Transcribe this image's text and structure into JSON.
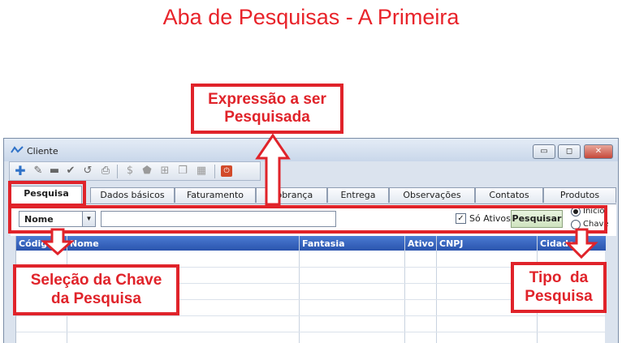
{
  "page_title": "Aba de Pesquisas - A Primeira",
  "window": {
    "title": "Cliente",
    "controls": {
      "minimize": "▭",
      "maximize": "◻",
      "close": "✕"
    }
  },
  "toolbar": {
    "icons": [
      "add-icon",
      "edit-icon",
      "delete-icon",
      "confirm-icon",
      "undo-icon",
      "print-icon",
      "money-icon",
      "tag-icon",
      "grid-icon",
      "copy-icon",
      "calendar-icon",
      "power-icon"
    ]
  },
  "tabs": [
    "Pesquisa",
    "Dados básicos",
    "Faturamento",
    "Cobrança",
    "Entrega",
    "Observações",
    "Contatos",
    "Produtos"
  ],
  "active_tab": "Pesquisa",
  "search": {
    "key_select": "Nome",
    "expression": "",
    "only_active_label": "Só Ativos",
    "only_active_checked": true,
    "button": "Pesquisar",
    "type_options": [
      "Início",
      "Chave"
    ],
    "type_selected": "Início"
  },
  "grid": {
    "columns": [
      "Código",
      "Nome",
      "Fantasia",
      "Ativo",
      "CNPJ",
      "Cidade"
    ],
    "rows": []
  },
  "annotations": {
    "expression": [
      "Expressão a ser",
      "Pesquisada"
    ],
    "key": [
      "Seleção da Chave",
      "da Pesquisa"
    ],
    "type": [
      "Tipo  da",
      "Pesquisa"
    ]
  },
  "colors": {
    "annotation": "#e0232a",
    "grid_header": "#2f5bb5",
    "window_bg": "#dbe3ee"
  }
}
